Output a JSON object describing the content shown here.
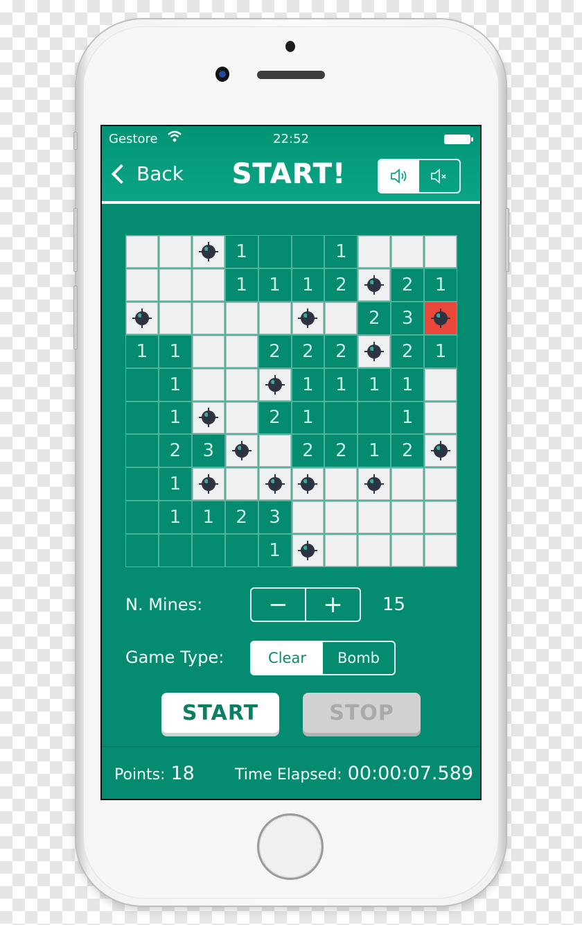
{
  "status_bar": {
    "carrier": "Gestore",
    "time": "22:52",
    "wifi_icon": "wifi-icon",
    "battery_icon": "battery-icon"
  },
  "nav": {
    "back_label": "Back",
    "title": "START!",
    "sound_on_icon": "🔈)",
    "sound_off_icon": "🔈×",
    "sound_selected": "on"
  },
  "board": {
    "rows": 10,
    "cols": 10,
    "legend": {
      "U": "unrevealed",
      "E": "revealed-empty",
      "M": "mine",
      "X": "exploded-mine",
      "1": "number",
      "2": "number",
      "3": "number"
    },
    "cells": [
      [
        "U",
        "U",
        "M",
        "1",
        "E",
        "E",
        "1",
        "U",
        "U",
        "U"
      ],
      [
        "U",
        "U",
        "U",
        "1",
        "1",
        "1",
        "2",
        "M",
        "2",
        "1"
      ],
      [
        "M",
        "U",
        "U",
        "U",
        "U",
        "M",
        "U",
        "2",
        "3",
        "X"
      ],
      [
        "1",
        "1",
        "U",
        "U",
        "2",
        "2",
        "2",
        "M",
        "2",
        "1"
      ],
      [
        "E",
        "1",
        "U",
        "U",
        "M",
        "1",
        "1",
        "1",
        "1",
        "U"
      ],
      [
        "E",
        "1",
        "M",
        "U",
        "2",
        "1",
        "E",
        "E",
        "1",
        "U"
      ],
      [
        "E",
        "2",
        "3",
        "M",
        "U",
        "2",
        "2",
        "1",
        "2",
        "M"
      ],
      [
        "E",
        "1",
        "M",
        "U",
        "M",
        "M",
        "U",
        "M",
        "U",
        "U"
      ],
      [
        "E",
        "1",
        "1",
        "2",
        "3",
        "U",
        "U",
        "U",
        "U",
        "U"
      ],
      [
        "E",
        "E",
        "E",
        "E",
        "1",
        "M",
        "U",
        "U",
        "U",
        "U"
      ]
    ]
  },
  "controls": {
    "mines_label": "N. Mines:",
    "minus_label": "−",
    "plus_label": "+",
    "mines_value": "15",
    "game_type_label": "Game Type:",
    "game_type_options": [
      "Clear",
      "Bomb"
    ],
    "game_type_selected": "Clear",
    "start_label": "START",
    "stop_label": "STOP"
  },
  "footer": {
    "points_label": "Points:",
    "points_value": "18",
    "time_label": "Time Elapsed:",
    "time_value": "00:00:07.589"
  },
  "colors": {
    "screen_bg": "#048b70",
    "header_bg": "#0aa586",
    "closed_cell": "#eff0f1",
    "exploded_cell": "#e8473a",
    "mine": "#2b3440"
  }
}
